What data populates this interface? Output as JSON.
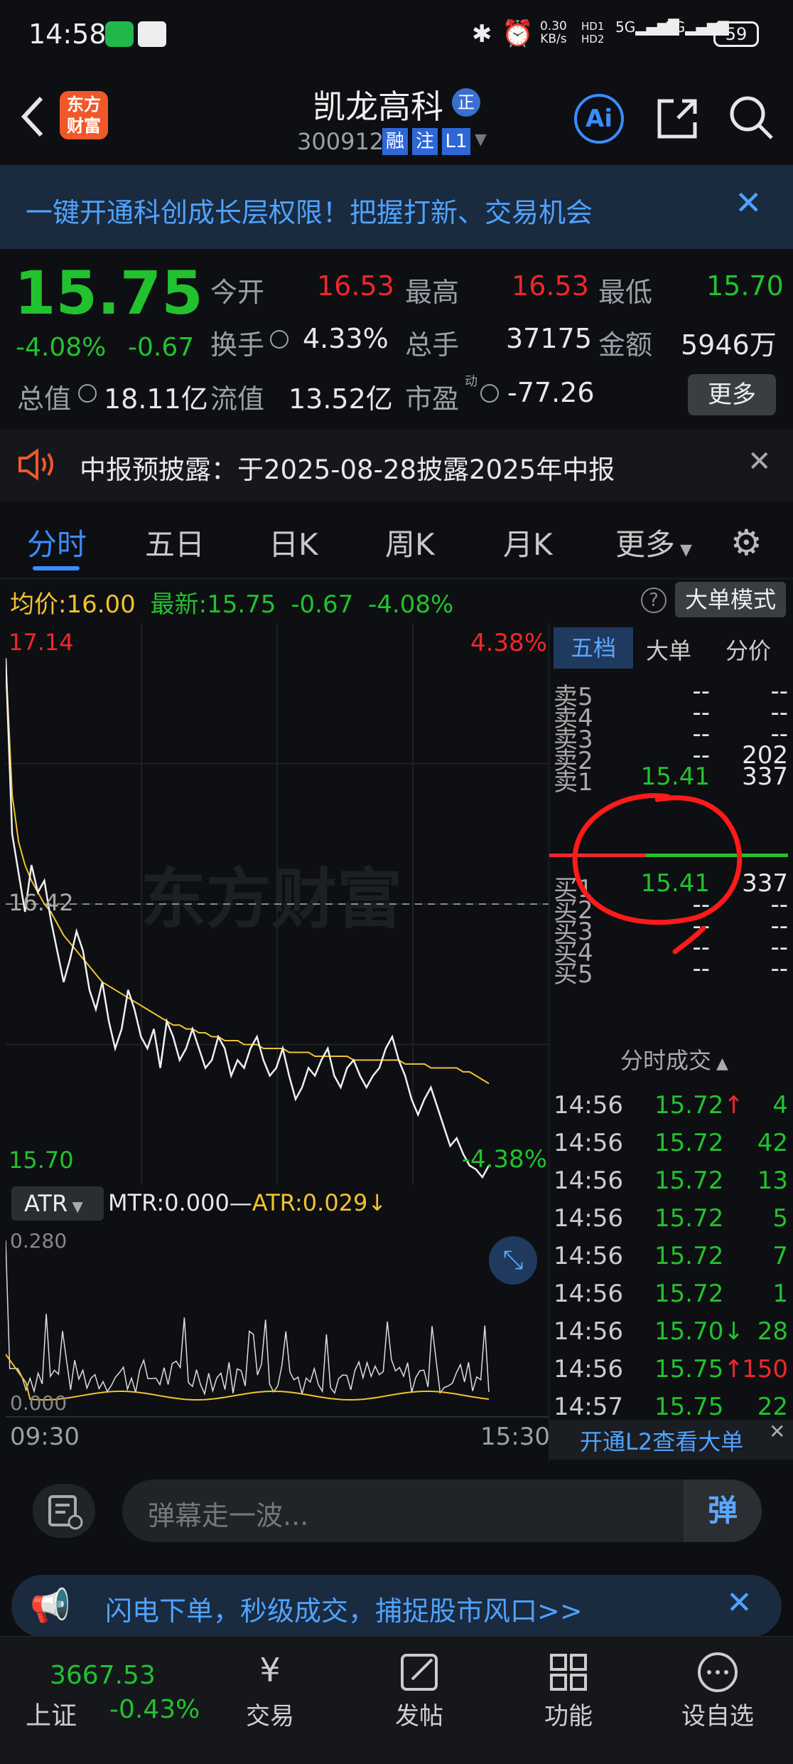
{
  "status": {
    "time": "14:58",
    "net_speed_top": "0.30",
    "net_speed_bottom": "KB/s",
    "battery": "59",
    "hd1": "HD1",
    "hd2": "HD2",
    "sig1": "5G",
    "sig2": "5G"
  },
  "header": {
    "title": "凯龙高科",
    "title_badge": "正",
    "code": "300912",
    "tag1": "融",
    "tag2": "注",
    "tag3": "L1",
    "logo_line1": "东方",
    "logo_line2": "财富",
    "ai": "Ai"
  },
  "banner": {
    "text": "一键开通科创成长层权限！把握打新、交易机会"
  },
  "quote": {
    "price": "15.75",
    "change_pct": "-4.08%",
    "change": "-0.67",
    "open_label": "今开",
    "open": "16.53",
    "high_label": "最高",
    "high": "16.53",
    "low_label": "最低",
    "low": "15.70",
    "turnover_label": "换手",
    "turnover": "4.33%",
    "volume_label": "总手",
    "volume": "37175",
    "amount_label": "金额",
    "amount": "5946万",
    "mcap_label": "总值",
    "mcap": "18.11亿",
    "float_label": "流值",
    "float": "13.52亿",
    "pe_label": "市盈",
    "pe_sup": "动",
    "pe": "-77.26",
    "more": "更多"
  },
  "notice": {
    "text": "中报预披露：于2025-08-28披露2025年中报"
  },
  "tabs": [
    "分时",
    "五日",
    "日K",
    "周K",
    "月K",
    "更多"
  ],
  "chart_header": {
    "avg_label": "均价:",
    "avg": "16.00",
    "latest_label": "最新:",
    "latest": "15.75",
    "chg": "-0.67",
    "pct": "-4.08%",
    "mode_btn": "大单模式"
  },
  "chart_data": {
    "type": "line",
    "title": "",
    "y_left_top": "17.14",
    "y_left_mid": "16.42",
    "y_left_bottom": "15.70",
    "y_right_top": "4.38%",
    "y_right_bottom": "-4.38%",
    "ylim": [
      15.7,
      17.14
    ],
    "prev_close": 16.42,
    "price": [
      17.05,
      16.6,
      16.5,
      16.4,
      16.52,
      16.45,
      16.48,
      16.38,
      16.3,
      16.22,
      16.28,
      16.35,
      16.3,
      16.2,
      16.15,
      16.22,
      16.12,
      16.05,
      16.1,
      16.2,
      16.15,
      16.08,
      16.05,
      16.1,
      16.0,
      16.12,
      16.08,
      16.02,
      16.05,
      16.1,
      16.05,
      16.0,
      16.02,
      16.08,
      16.05,
      15.98,
      16.02,
      16.0,
      16.05,
      16.08,
      16.02,
      15.98,
      16.0,
      16.05,
      15.98,
      15.92,
      15.95,
      16.0,
      15.98,
      16.02,
      16.05,
      15.98,
      15.95,
      16.0,
      16.02,
      15.98,
      15.95,
      15.98,
      16.0,
      16.05,
      16.08,
      16.02,
      15.98,
      15.92,
      15.88,
      15.92,
      15.95,
      15.9,
      15.85,
      15.8,
      15.82,
      15.78,
      15.75,
      15.74,
      15.72,
      15.75
    ],
    "avg": [
      17.05,
      16.7,
      16.58,
      16.52,
      16.48,
      16.45,
      16.42,
      16.4,
      16.37,
      16.34,
      16.32,
      16.3,
      16.28,
      16.26,
      16.24,
      16.22,
      16.21,
      16.2,
      16.19,
      16.18,
      16.17,
      16.16,
      16.15,
      16.14,
      16.13,
      16.12,
      16.11,
      16.11,
      16.1,
      16.1,
      16.09,
      16.09,
      16.08,
      16.08,
      16.07,
      16.07,
      16.07,
      16.06,
      16.06,
      16.06,
      16.05,
      16.05,
      16.05,
      16.05,
      16.04,
      16.04,
      16.04,
      16.04,
      16.03,
      16.03,
      16.03,
      16.03,
      16.03,
      16.03,
      16.02,
      16.02,
      16.02,
      16.02,
      16.02,
      16.02,
      16.02,
      16.02,
      16.01,
      16.01,
      16.01,
      16.01,
      16.0,
      16.0,
      16.0,
      16.0,
      16.0,
      15.99,
      15.99,
      15.98,
      15.97,
      15.96
    ],
    "x_start": "09:30",
    "x_end": "15:30",
    "watermark": "东方财富"
  },
  "indicator": {
    "name": "ATR",
    "mtr": "MTR:0.000",
    "dash": "—",
    "atr": "ATR:0.029",
    "arrow": "↓",
    "top": "0.280",
    "bottom": "0.000"
  },
  "book_tabs": [
    "五档",
    "大单",
    "分价"
  ],
  "sell": [
    {
      "label": "卖5",
      "price": "--",
      "vol": "--"
    },
    {
      "label": "卖4",
      "price": "--",
      "vol": "--"
    },
    {
      "label": "卖3",
      "price": "--",
      "vol": "--"
    },
    {
      "label": "卖2",
      "price": "--",
      "vol": "202"
    },
    {
      "label": "卖1",
      "price": "15.41",
      "vol": "337"
    }
  ],
  "buy": [
    {
      "label": "买1",
      "price": "15.41",
      "vol": "337"
    },
    {
      "label": "买2",
      "price": "--",
      "vol": "--"
    },
    {
      "label": "买3",
      "price": "--",
      "vol": "--"
    },
    {
      "label": "买4",
      "price": "--",
      "vol": "--"
    },
    {
      "label": "买5",
      "price": "--",
      "vol": "--"
    }
  ],
  "trades_title": "分时成交",
  "trades": [
    {
      "t": "14:56",
      "p": "15.72",
      "a": "↑",
      "v": "4",
      "c": "g"
    },
    {
      "t": "14:56",
      "p": "15.72",
      "a": "",
      "v": "42",
      "c": "g"
    },
    {
      "t": "14:56",
      "p": "15.72",
      "a": "",
      "v": "13",
      "c": "g"
    },
    {
      "t": "14:56",
      "p": "15.72",
      "a": "",
      "v": "5",
      "c": "g"
    },
    {
      "t": "14:56",
      "p": "15.72",
      "a": "",
      "v": "7",
      "c": "g"
    },
    {
      "t": "14:56",
      "p": "15.72",
      "a": "",
      "v": "1",
      "c": "g"
    },
    {
      "t": "14:56",
      "p": "15.70",
      "a": "↓",
      "v": "28",
      "c": "g"
    },
    {
      "t": "14:56",
      "p": "15.75",
      "a": "↑",
      "v": "150",
      "c": "r"
    },
    {
      "t": "14:57",
      "p": "15.75",
      "a": "",
      "v": "22",
      "c": "g"
    }
  ],
  "l2_link": "开通L2查看大单",
  "danmu": {
    "placeholder": "弹幕走一波...",
    "send": "弹"
  },
  "promo": {
    "text": "闪电下单，秒级成交，捕捉股市风口>>"
  },
  "nav": {
    "index_value": "3667.53",
    "index_name": "上证",
    "index_change": "-0.43%",
    "items": [
      "交易",
      "发帖",
      "功能",
      "设自选"
    ]
  },
  "colors": {
    "up": "#f0272d",
    "down": "#22c22e",
    "accent": "#3b8cff",
    "avg_line": "#f2c230"
  }
}
